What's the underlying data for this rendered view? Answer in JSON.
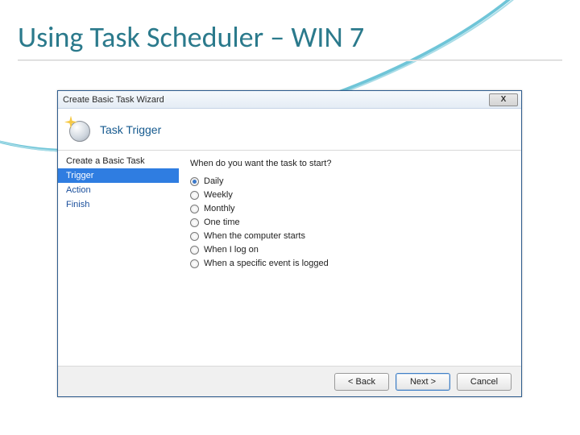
{
  "slide": {
    "title": "Using Task Scheduler – WIN 7"
  },
  "window": {
    "title": "Create Basic Task Wizard",
    "close_label": "X"
  },
  "header": {
    "title": "Task Trigger"
  },
  "sidebar": {
    "heading": "Create a Basic Task",
    "steps": {
      "trigger": "Trigger",
      "action": "Action",
      "finish": "Finish"
    }
  },
  "main": {
    "prompt": "When do you want the task to start?",
    "options": {
      "daily": "Daily",
      "weekly": "Weekly",
      "monthly": "Monthly",
      "onetime": "One time",
      "computer_starts": "When the computer starts",
      "logon": "When I log on",
      "event_logged": "When a specific event is logged"
    },
    "selected": "daily"
  },
  "footer": {
    "back": "< Back",
    "next": "Next >",
    "cancel": "Cancel"
  }
}
